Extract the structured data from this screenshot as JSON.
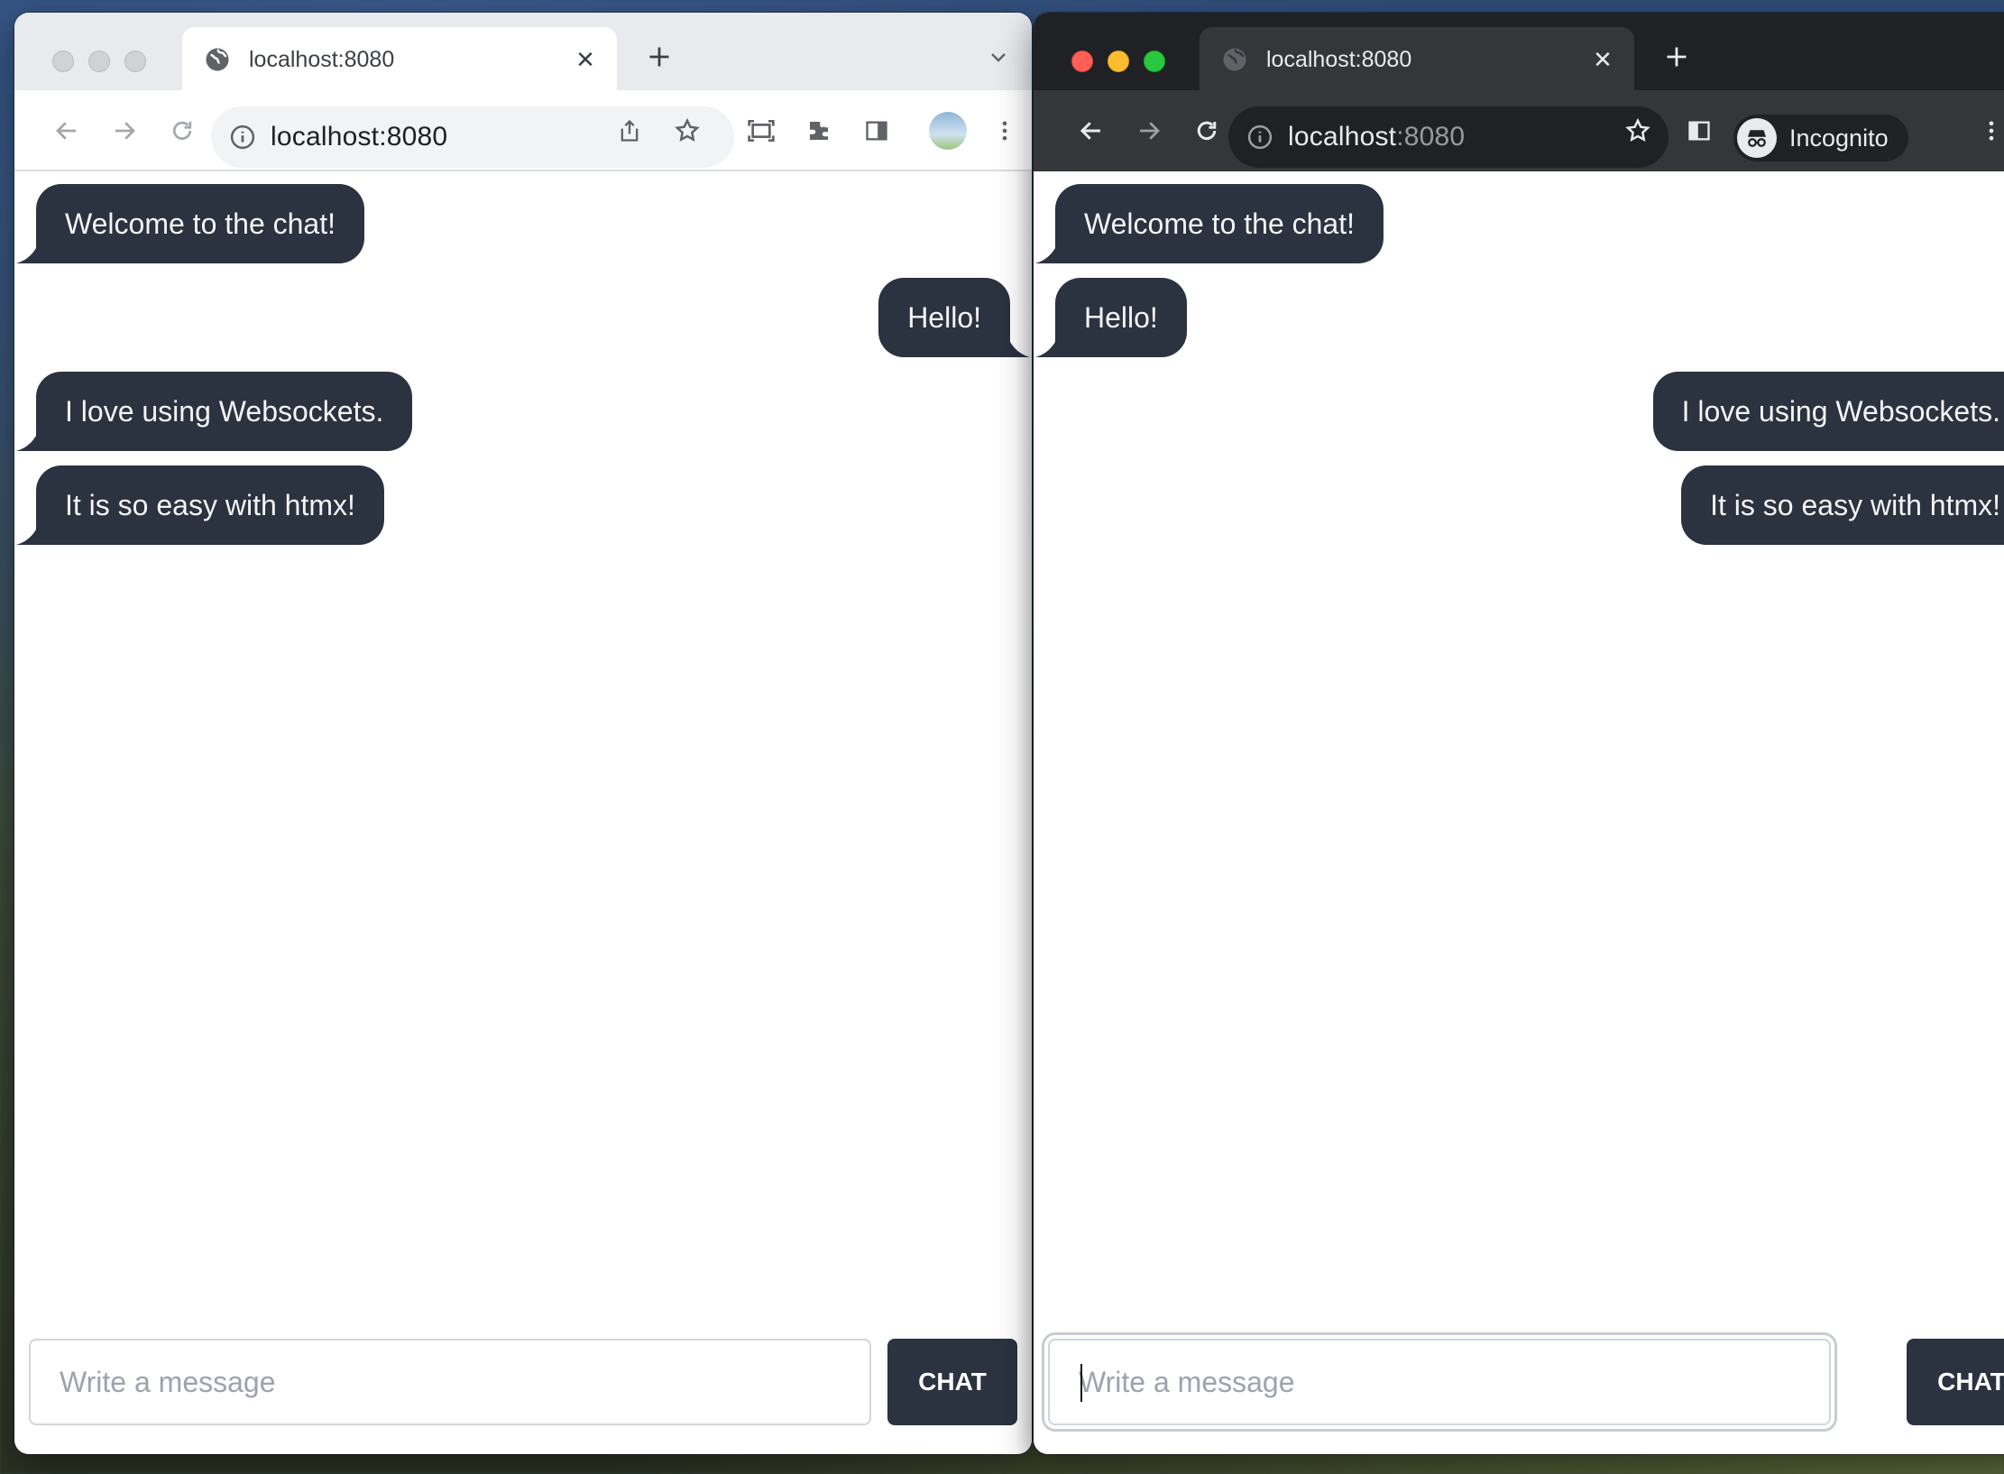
{
  "colors": {
    "bubble": "#2b3240",
    "bubble_text": "#f3f4f6",
    "chat_button": "#2b3240",
    "placeholder": "#9ca3af"
  },
  "windows": [
    {
      "theme": "light",
      "tab": {
        "title": "localhost:8080",
        "favicon": "globe-icon"
      },
      "address": {
        "host": "localhost",
        "port": ":8080"
      },
      "messages": [
        {
          "text": "Welcome to the chat!",
          "side": "left"
        },
        {
          "text": "Hello!",
          "side": "right"
        },
        {
          "text": "I love using Websockets.",
          "side": "left"
        },
        {
          "text": "It is so easy with htmx!",
          "side": "left"
        }
      ],
      "composer": {
        "placeholder": "Write a message",
        "value": "",
        "button": "CHAT"
      }
    },
    {
      "theme": "dark",
      "tab": {
        "title": "localhost:8080",
        "favicon": "globe-icon"
      },
      "address": {
        "host": "localhost",
        "port": ":8080"
      },
      "profile": {
        "label": "Incognito"
      },
      "messages": [
        {
          "text": "Welcome to the chat!",
          "side": "left"
        },
        {
          "text": "Hello!",
          "side": "left"
        },
        {
          "text": "I love using Websockets.",
          "side": "right"
        },
        {
          "text": "It is so easy with htmx!",
          "side": "right"
        }
      ],
      "composer": {
        "placeholder": "Write a message",
        "value": "",
        "button": "CHAT"
      }
    }
  ]
}
